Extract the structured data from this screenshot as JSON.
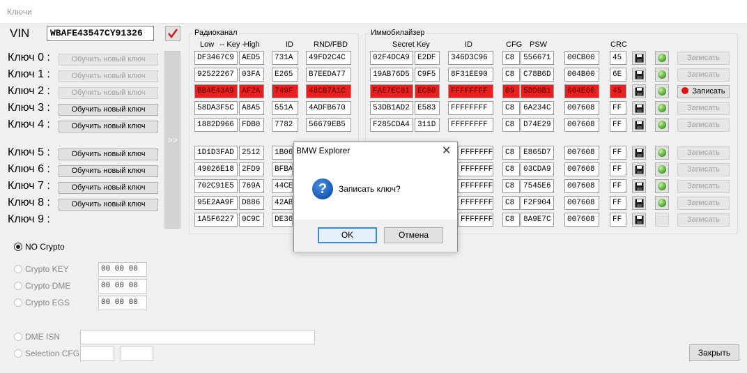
{
  "window": {
    "title": "Ключи"
  },
  "vin": {
    "label": "VIN",
    "value": "WBAFE43547CY91326"
  },
  "keys": {
    "labels": [
      "Ключ 0 :",
      "Ключ 1 :",
      "Ключ 2 :",
      "Ключ 3 :",
      "Ключ 4 :",
      "Ключ 5 :",
      "Ключ 6 :",
      "Ключ 7 :",
      "Ключ 8 :",
      "Ключ 9 :"
    ],
    "learn_button": "Обучить новый ключ",
    "arrow": ">>"
  },
  "radio_group": {
    "title": "Радиоканал",
    "headers": {
      "low": "Low",
      "key": "-- Key -",
      "high": "High",
      "id": "ID",
      "rnd": "RND/FBD"
    },
    "rows": [
      {
        "low": "DF3467C9",
        "high": "AED5",
        "id": "731A",
        "rnd": "49FD2C4C"
      },
      {
        "low": "92522267",
        "high": "03FA",
        "id": "E265",
        "rnd": "B7EEDA77"
      },
      {
        "low": "BB4E43A9",
        "high": "AF2A",
        "id": "749F",
        "rnd": "48CB7A1C"
      },
      {
        "low": "58DA3F5C",
        "high": "A8A5",
        "id": "551A",
        "rnd": "4ADFB670"
      },
      {
        "low": "1882D966",
        "high": "FDB0",
        "id": "7782",
        "rnd": "56679EB5"
      },
      {
        "low": "1D1D3FAD",
        "high": "2512",
        "id": "1B06",
        "rnd": ""
      },
      {
        "low": "49026E18",
        "high": "2FD9",
        "id": "BFBA",
        "rnd": ""
      },
      {
        "low": "702C91E5",
        "high": "769A",
        "id": "44CE",
        "rnd": ""
      },
      {
        "low": "95E2AA9F",
        "high": "D886",
        "id": "42AB",
        "rnd": ""
      },
      {
        "low": "1A5F6227",
        "high": "0C9C",
        "id": "DE36",
        "rnd": ""
      }
    ]
  },
  "immo_group": {
    "title": "Иммобилайзер",
    "headers": {
      "secret": "Secret Key",
      "id": "ID",
      "cfg": "CFG",
      "psw": "PSW",
      "crc": "CRC"
    },
    "rows": [
      {
        "s1": "02F4DCA9",
        "s2": "E2DF",
        "id": "346D3C96",
        "cfg": "C8",
        "psw": "556671",
        "crc_val": "00CB00",
        "crc": "45",
        "write": "Записать"
      },
      {
        "s1": "19AB76D5",
        "s2": "C9F5",
        "id": "8F31EE90",
        "cfg": "C8",
        "psw": "C78B6D",
        "crc_val": "004B00",
        "crc": "6E",
        "write": "Записать"
      },
      {
        "s1": "FAE7EC01",
        "s2": "EC80",
        "id": "FFFFFFFF",
        "cfg": "09",
        "psw": "5DD0B1",
        "crc_val": "004E00",
        "crc": "45",
        "write": "Записать"
      },
      {
        "s1": "53DB1AD2",
        "s2": "E583",
        "id": "FFFFFFFF",
        "cfg": "C8",
        "psw": "6A234C",
        "crc_val": "007608",
        "crc": "FF",
        "write": "Записать"
      },
      {
        "s1": "F285CDA4",
        "s2": "311D",
        "id": "FFFFFFFF",
        "cfg": "C8",
        "psw": "D74E29",
        "crc_val": "007608",
        "crc": "FF",
        "write": "Записать"
      },
      {
        "s1": "",
        "s2": "",
        "id": "FFFFFFF",
        "cfg": "C8",
        "psw": "E865D7",
        "crc_val": "007608",
        "crc": "FF",
        "write": "Записать"
      },
      {
        "s1": "",
        "s2": "",
        "id": "FFFFFFF",
        "cfg": "C8",
        "psw": "03CDA9",
        "crc_val": "007608",
        "crc": "FF",
        "write": "Записать"
      },
      {
        "s1": "",
        "s2": "",
        "id": "FFFFFFF",
        "cfg": "C8",
        "psw": "7545E6",
        "crc_val": "007608",
        "crc": "FF",
        "write": "Записать"
      },
      {
        "s1": "",
        "s2": "",
        "id": "FFFFFFF",
        "cfg": "C8",
        "psw": "F2F904",
        "crc_val": "007608",
        "crc": "FF",
        "write": "Записать"
      },
      {
        "s1": "",
        "s2": "",
        "id": "FFFFFFF",
        "cfg": "C8",
        "psw": "8A9E7C",
        "crc_val": "007608",
        "crc": "FF",
        "write": "Записать"
      }
    ]
  },
  "crypto": {
    "no_crypto": "NO Crypto",
    "key": "Crypto KEY",
    "dme": "Crypto DME",
    "egs": "Crypto EGS",
    "key_val": "00 00 00",
    "dme_val": "00 00 00",
    "egs_val": "00 00 00"
  },
  "bottom": {
    "dme_isn": "DME ISN",
    "selection_cfg": "Selection CFG",
    "close": "Закрыть"
  },
  "dialog": {
    "title": "BMW Explorer",
    "message": "Записать ключ?",
    "ok": "OK",
    "cancel": "Отмена"
  },
  "colors": {
    "highlight_row": "#e82020",
    "accent": "#3c8ad6",
    "record_dot": "#e01010"
  }
}
